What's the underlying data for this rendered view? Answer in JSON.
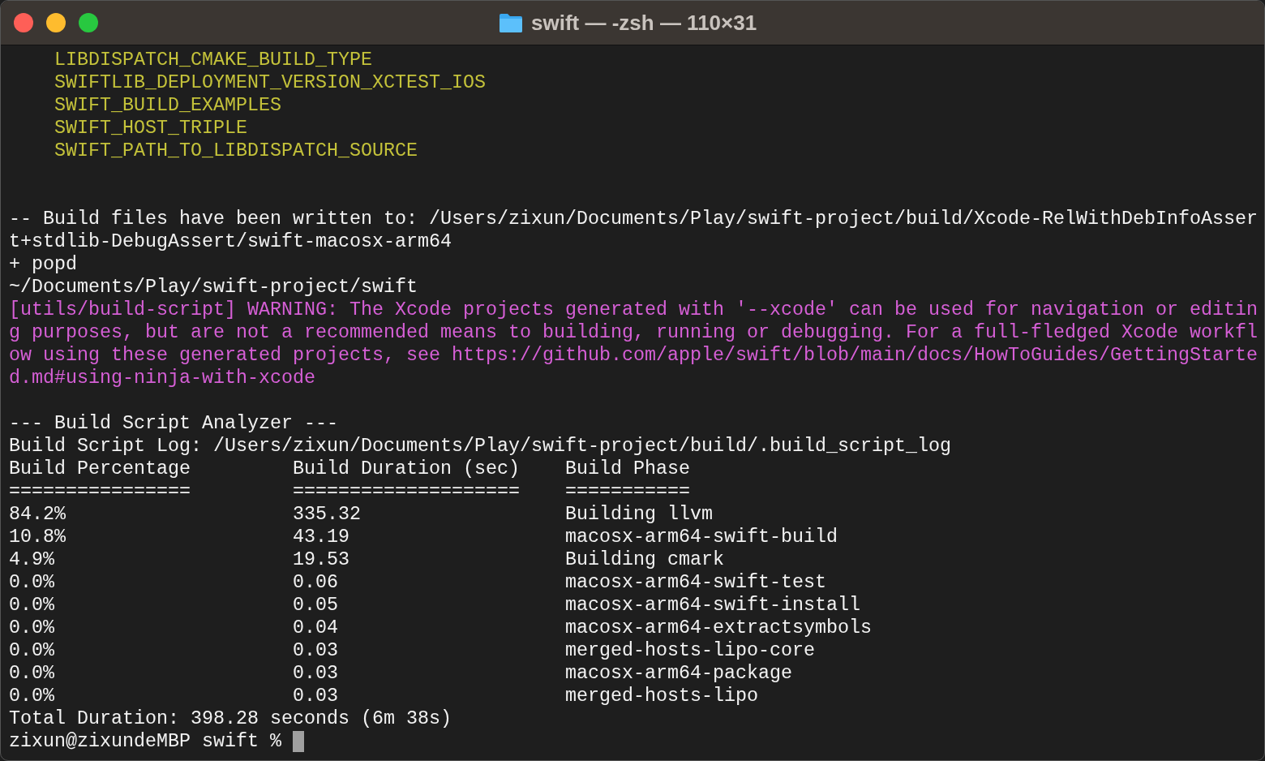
{
  "window": {
    "title": "swift — -zsh — 110×31"
  },
  "lines": [
    {
      "kind": "highlight",
      "text": "    LIBDISPATCH_CMAKE_BUILD_TYPE"
    },
    {
      "kind": "highlight",
      "text": "    SWIFTLIB_DEPLOYMENT_VERSION_XCTEST_IOS"
    },
    {
      "kind": "highlight",
      "text": "    SWIFT_BUILD_EXAMPLES"
    },
    {
      "kind": "highlight",
      "text": "    SWIFT_HOST_TRIPLE"
    },
    {
      "kind": "highlight",
      "text": "    SWIFT_PATH_TO_LIBDISPATCH_SOURCE"
    },
    {
      "kind": "blank"
    },
    {
      "kind": "blank"
    },
    {
      "kind": "plain",
      "text": "-- Build files have been written to: /Users/zixun/Documents/Play/swift-project/build/Xcode-RelWithDebInfoAsser"
    },
    {
      "kind": "plain",
      "text": "t+stdlib-DebugAssert/swift-macosx-arm64"
    },
    {
      "kind": "plain",
      "text": "+ popd"
    },
    {
      "kind": "plain",
      "text": "~/Documents/Play/swift-project/swift"
    },
    {
      "kind": "warning",
      "text": "[utils/build-script] WARNING: The Xcode projects generated with '--xcode' can be used for navigation or editin"
    },
    {
      "kind": "warning",
      "text": "g purposes, but are not a recommended means to building, running or debugging. For a full-fledged Xcode workfl"
    },
    {
      "kind": "warning",
      "text": "ow using these generated projects, see https://github.com/apple/swift/blob/main/docs/HowToGuides/GettingStarte"
    },
    {
      "kind": "warning",
      "text": "d.md#using-ninja-with-xcode"
    },
    {
      "kind": "blank"
    },
    {
      "kind": "plain",
      "text": "--- Build Script Analyzer ---"
    },
    {
      "kind": "plain",
      "text": "Build Script Log: /Users/zixun/Documents/Play/swift-project/build/.build_script_log"
    },
    {
      "kind": "plain",
      "text": "Build Percentage         Build Duration (sec)    Build Phase"
    },
    {
      "kind": "plain",
      "text": "================         ====================    ==========="
    },
    {
      "kind": "plain",
      "text": "84.2%                    335.32                  Building llvm"
    },
    {
      "kind": "plain",
      "text": "10.8%                    43.19                   macosx-arm64-swift-build"
    },
    {
      "kind": "plain",
      "text": "4.9%                     19.53                   Building cmark"
    },
    {
      "kind": "plain",
      "text": "0.0%                     0.06                    macosx-arm64-swift-test"
    },
    {
      "kind": "plain",
      "text": "0.0%                     0.05                    macosx-arm64-swift-install"
    },
    {
      "kind": "plain",
      "text": "0.0%                     0.04                    macosx-arm64-extractsymbols"
    },
    {
      "kind": "plain",
      "text": "0.0%                     0.03                    merged-hosts-lipo-core"
    },
    {
      "kind": "plain",
      "text": "0.0%                     0.03                    macosx-arm64-package"
    },
    {
      "kind": "plain",
      "text": "0.0%                     0.03                    merged-hosts-lipo"
    },
    {
      "kind": "plain",
      "text": "Total Duration: 398.28 seconds (6m 38s)"
    }
  ],
  "prompt": "zixun@zixundeMBP swift %"
}
